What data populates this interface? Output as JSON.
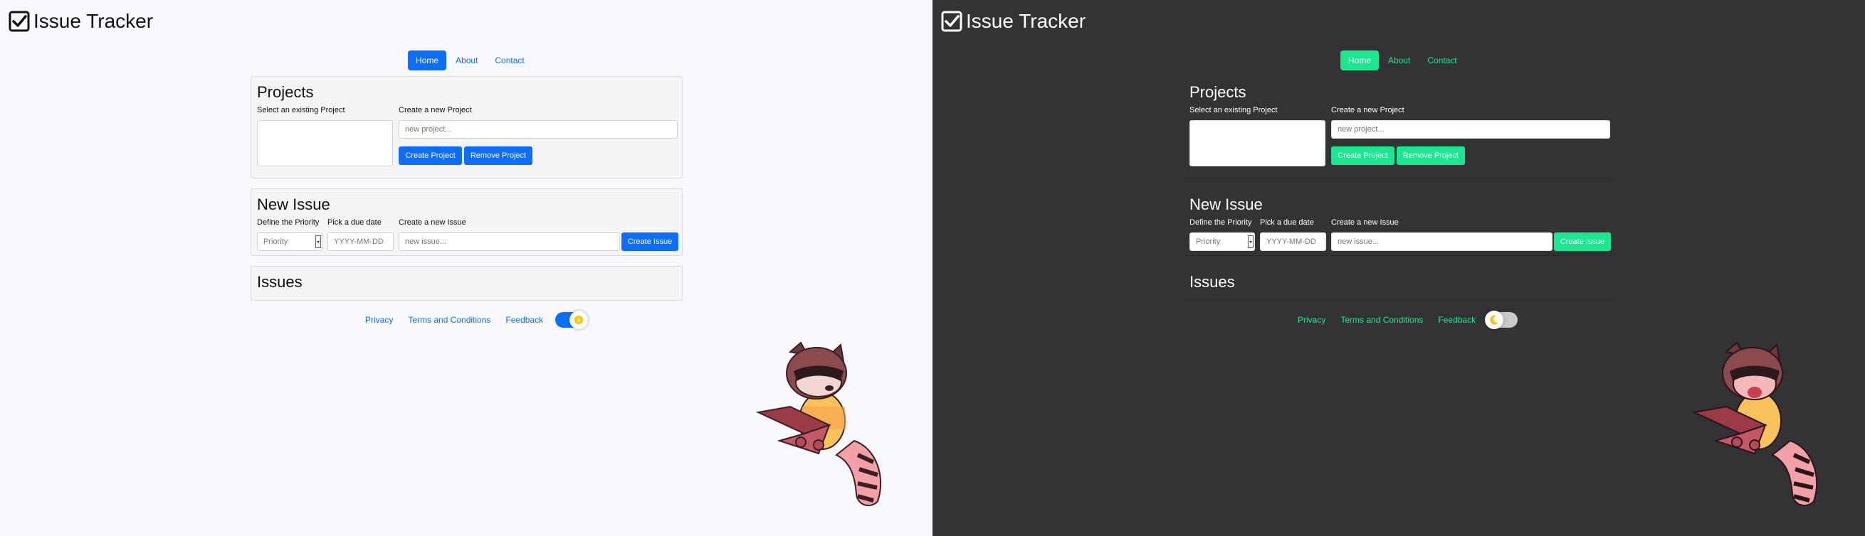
{
  "app": {
    "title": "Issue Tracker"
  },
  "nav": {
    "home": "Home",
    "about": "About",
    "contact": "Contact"
  },
  "projects": {
    "title": "Projects",
    "select_label": "Select an existing Project",
    "create_label": "Create a new Project",
    "input_placeholder": "new project...",
    "create_button": "Create Project",
    "remove_button": "Remove Project"
  },
  "new_issue": {
    "title": "New Issue",
    "priority_label": "Define the Priority",
    "priority_value": "Priority",
    "date_label": "Pick a due date",
    "date_placeholder": "YYYY-MM-DD",
    "issue_label": "Create a new Issue",
    "issue_placeholder": "new issue...",
    "create_button": "Create Issue"
  },
  "issues": {
    "title": "Issues"
  },
  "footer": {
    "privacy": "Privacy",
    "terms": "Terms and Conditions",
    "feedback": "Feedback"
  },
  "themes": {
    "light": {
      "accent": "#0d6efd",
      "background": "#f8f9fc",
      "toggle_icon": "sun-icon"
    },
    "dark": {
      "accent": "#19e890",
      "background": "#333335",
      "toggle_icon": "moon-icon"
    }
  }
}
